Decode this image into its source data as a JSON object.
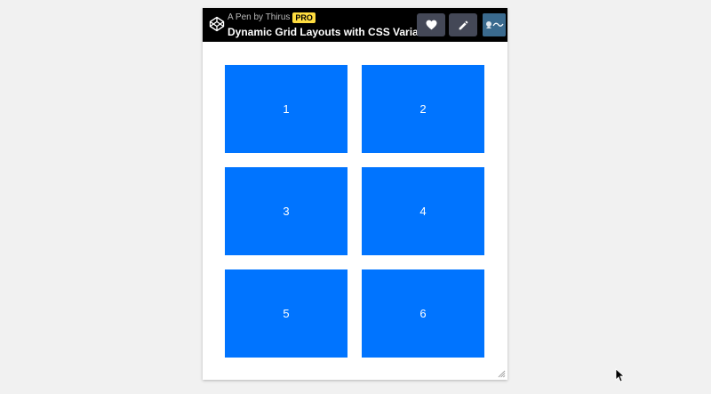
{
  "header": {
    "byline": "A Pen by Thirus",
    "badge": "PRO",
    "title": "Dynamic Grid Layouts with CSS Variables",
    "logo_icon": "codepen-logo-icon",
    "like_icon": "heart-icon",
    "edit_icon": "pencil-icon",
    "avatar_alt": "Thirus avatar"
  },
  "grid": {
    "items": [
      "1",
      "2",
      "3",
      "4",
      "5",
      "6"
    ]
  },
  "colors": {
    "header_bg": "#000000",
    "button_bg": "#444857",
    "badge_bg": "#ffdd40",
    "grid_item_bg": "#0074ff",
    "page_bg": "#f1f1f1"
  }
}
